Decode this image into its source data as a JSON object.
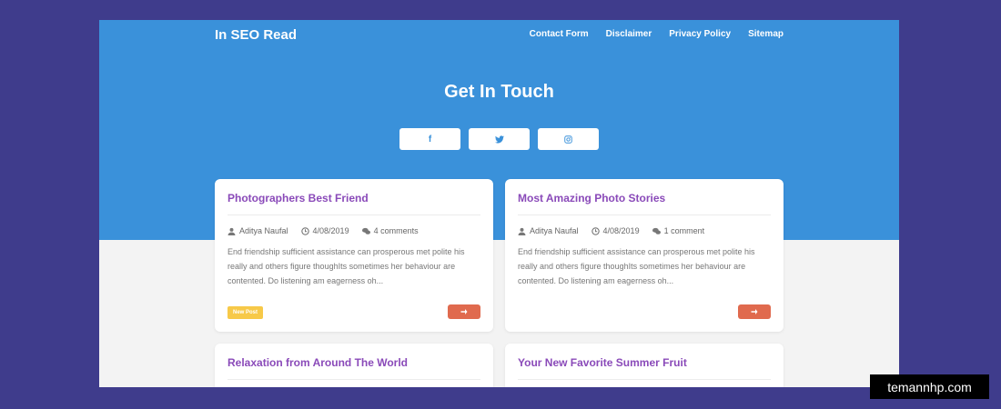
{
  "header": {
    "brand": "In SEO Read",
    "nav": [
      {
        "label": "Contact Form"
      },
      {
        "label": "Disclaimer"
      },
      {
        "label": "Privacy Policy"
      },
      {
        "label": "Sitemap"
      }
    ]
  },
  "hero": {
    "title": "Get In Touch",
    "social": [
      {
        "icon": "facebook-icon",
        "glyph": "f"
      },
      {
        "icon": "twitter-icon"
      },
      {
        "icon": "instagram-icon"
      }
    ]
  },
  "posts": [
    {
      "title": "Photographers Best Friend",
      "author": "Aditya Naufal",
      "date": "4/08/2019",
      "comments": "4 comments",
      "excerpt": "End friendship sufficient assistance can prosperous met polite his really and others figure thoughIts sometimes her behaviour are contented. Do listening am eagerness oh...",
      "badge": "New Post"
    },
    {
      "title": "Most Amazing Photo Stories",
      "author": "Aditya Naufal",
      "date": "4/08/2019",
      "comments": "1 comment",
      "excerpt": "End friendship sufficient assistance can prosperous met polite his really and others figure thoughIts sometimes her behaviour are contented. Do listening am eagerness oh...",
      "badge": ""
    },
    {
      "title": "Relaxation from Around The World"
    },
    {
      "title": "Your New Favorite Summer Fruit"
    }
  ],
  "watermark": "temannhp.com",
  "colors": {
    "page_bg": "#3f3c8c",
    "hero_bg": "#3a91da",
    "title_purple": "#8a4ab9",
    "arrow_btn": "#e06a4e",
    "badge": "#f7c948"
  }
}
